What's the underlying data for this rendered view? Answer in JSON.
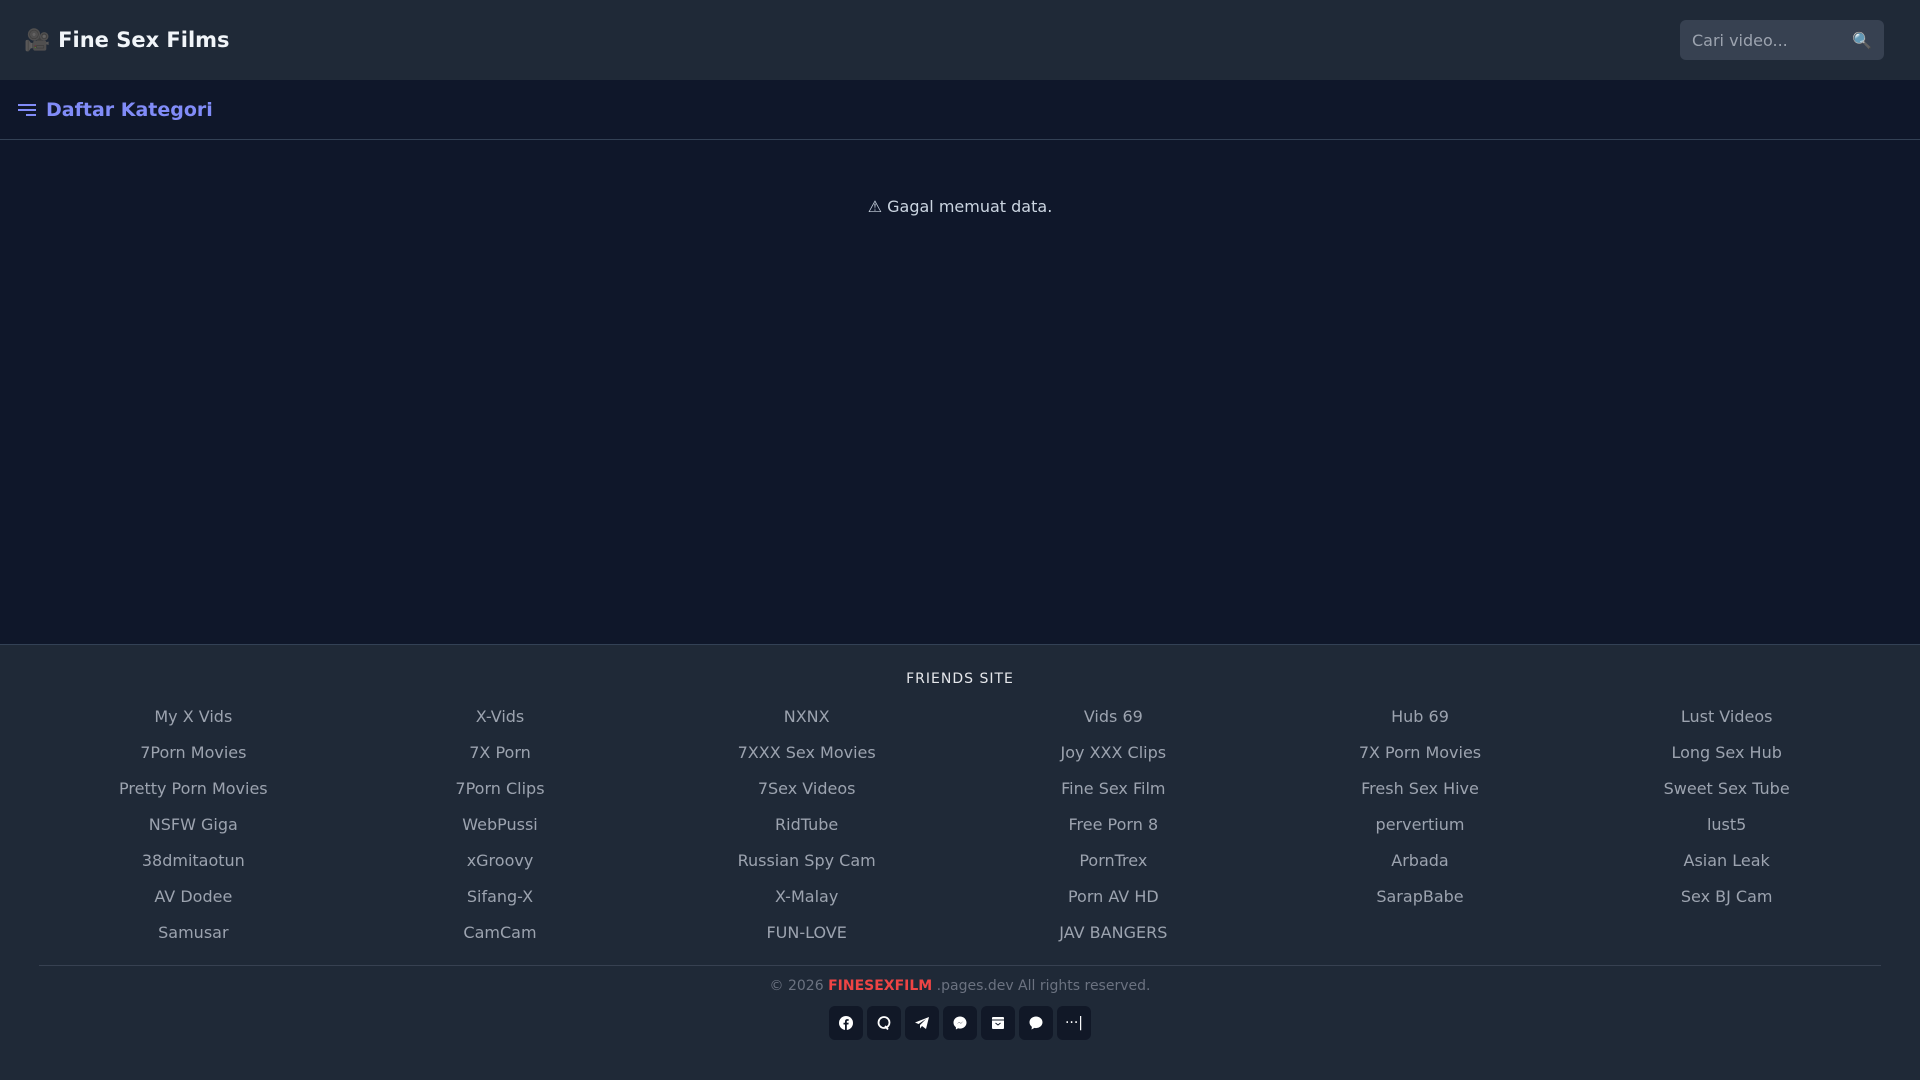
{
  "header": {
    "logo_icon": "movie-camera",
    "title": "Fine Sex Films",
    "search_placeholder": "Cari video...",
    "search_icon": "🔍"
  },
  "nav": {
    "label": "Daftar Kategori"
  },
  "main": {
    "error": "⚠ Gagal memuat data."
  },
  "footer": {
    "title": "FRIENDS SITE",
    "links": [
      "My X Vids",
      "X-Vids",
      "NXNX",
      "Vids 69",
      "Hub 69",
      "Lust Videos",
      "7Porn Movies",
      "7X Porn",
      "7XXX Sex Movies",
      "Joy XXX Clips",
      "7X Porn Movies",
      "Long Sex Hub",
      "Pretty Porn Movies",
      "7Porn Clips",
      "7Sex Videos",
      "Fine Sex Film",
      "Fresh Sex Hive",
      "Sweet Sex Tube",
      "NSFW Giga",
      "WebPussi",
      "RidTube",
      "Free Porn 8",
      "pervertium",
      "lust5",
      "38dmitaotun",
      "xGroovy",
      "Russian Spy Cam",
      "PornTrex",
      "Arbada",
      "Asian Leak",
      "AV Dodee",
      "Sifang-X",
      "X-Malay",
      "Porn AV HD",
      "SarapBabe",
      "Sex BJ Cam",
      "Samusar",
      "CamCam",
      "FUN-LOVE",
      "JAV BANGERS"
    ],
    "copy_prefix": "© 2026",
    "copy_brand": "FINESEXFILM",
    "copy_suffix": ".pages.dev All rights reserved.",
    "share_icons": [
      "facebook",
      "quora",
      "telegram",
      "messenger",
      "email",
      "chat",
      "more"
    ],
    "accent": "#ef4444"
  }
}
